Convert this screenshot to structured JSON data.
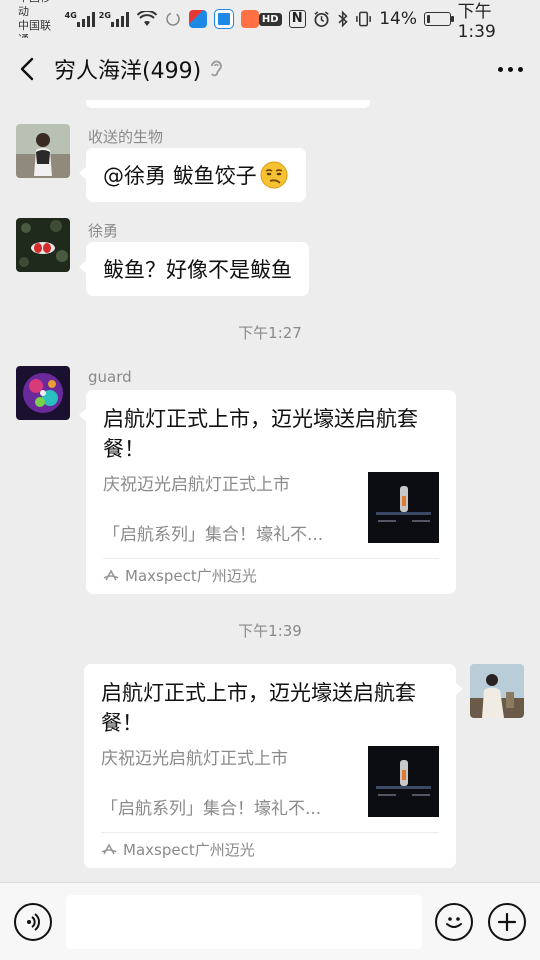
{
  "status_bar": {
    "carrier1": "中国移动",
    "carrier2": "中国联通",
    "net1": "4G",
    "net2": "2G",
    "hd": "HD",
    "nfc": "N",
    "battery_text": "14%",
    "battery_level": 0.14,
    "time": "下午1:39"
  },
  "header": {
    "title": "穷人海洋(499)",
    "back_icon": "chevron-left-icon",
    "ear_icon": "ear-icon",
    "more_icon": "more-dots-icon"
  },
  "messages": [
    {
      "sender": "收送的生物",
      "text_before": "@徐勇  鲅鱼饺子",
      "emoji": "smirk-face-icon"
    },
    {
      "sender": "徐勇",
      "text": "鲅鱼？好像不是鲅鱼"
    }
  ],
  "timestamps": [
    "下午1:27",
    "下午1:39"
  ],
  "link_messages": [
    {
      "sender": "guard",
      "title": "启航灯正式上市，迈光壕送启航套餐！",
      "desc_line1": "庆祝迈光启航灯正式上市",
      "desc_line2": "「启航系列」集合！壕礼不...",
      "source": "Maxspect广州迈光"
    },
    {
      "title": "启航灯正式上市，迈光壕送启航套餐！",
      "desc_line1": "庆祝迈光启航灯正式上市",
      "desc_line2": "「启航系列」集合！壕礼不...",
      "source": "Maxspect广州迈光"
    }
  ],
  "input_bar": {
    "voice_icon": "voice-icon",
    "emoji_icon": "emoji-icon",
    "plus_icon": "plus-icon",
    "input_value": ""
  }
}
